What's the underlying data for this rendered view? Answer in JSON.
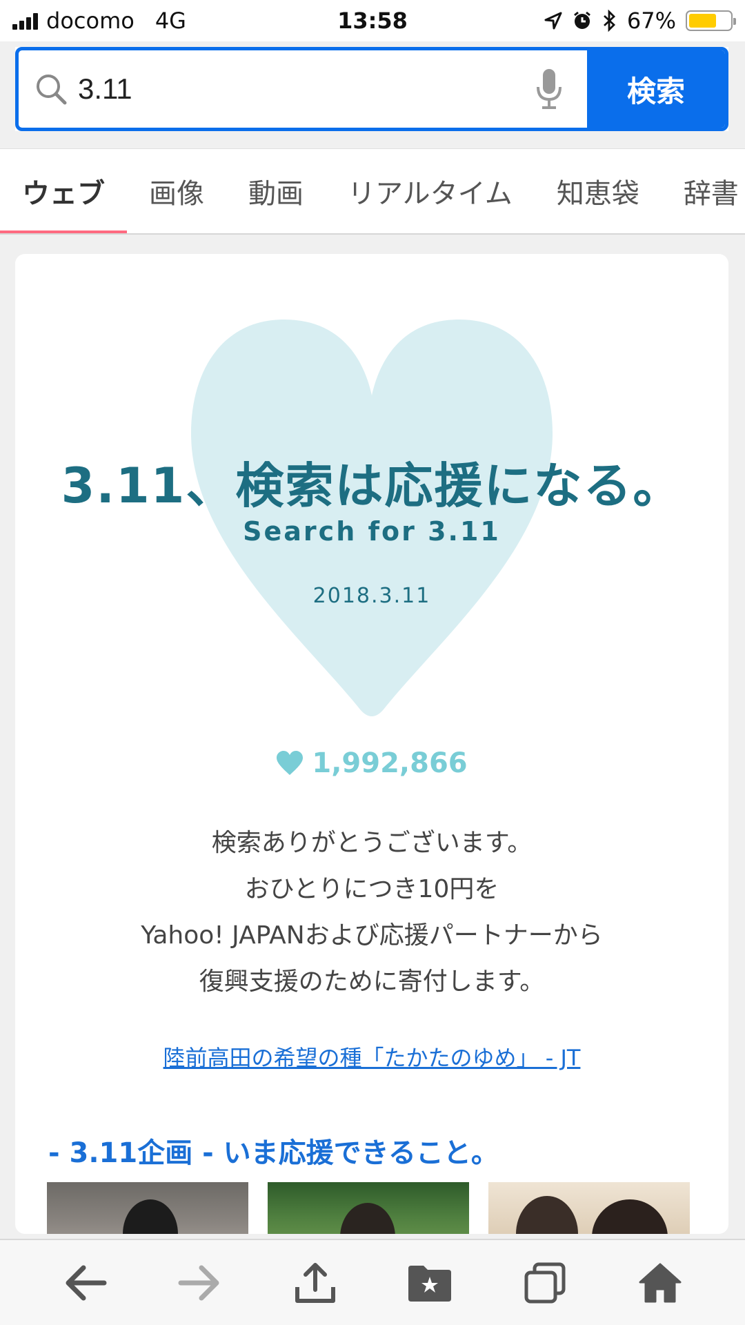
{
  "status": {
    "carrier": "docomo",
    "network": "4G",
    "time": "13:58",
    "battery": "67%",
    "battery_level": 0.67
  },
  "search": {
    "query": "3.11",
    "button_label": "検索"
  },
  "tabs": [
    {
      "label": "ウェブ",
      "active": true
    },
    {
      "label": "画像"
    },
    {
      "label": "動画"
    },
    {
      "label": "リアルタイム"
    },
    {
      "label": "知恵袋"
    },
    {
      "label": "辞書"
    }
  ],
  "campaign": {
    "headline": "3.11、検索は応援になる。",
    "subtitle": "Search for 3.11",
    "date": "2018.3.11",
    "count": "1,992,866",
    "thanks_lines": [
      "検索ありがとうございます。",
      "おひとりにつき10円を",
      "Yahoo! JAPANおよび応援パートナーから",
      "復興支援のために寄付します。"
    ],
    "partner_link": "陸前高田の希望の種「たかたのゆめ」 - JT",
    "project_title": "- 3.11企画 - いま応援できること。"
  },
  "colors": {
    "accent_blue": "#0a6eeb",
    "heart_fill": "#d8eef2",
    "headline_teal": "#1d6e82",
    "count_teal": "#79cdd6",
    "tab_underline": "#ff6a80"
  },
  "toolbar": {
    "icons": [
      "back-icon",
      "forward-icon",
      "share-icon",
      "bookmark-icon",
      "tabs-icon",
      "home-icon"
    ]
  }
}
